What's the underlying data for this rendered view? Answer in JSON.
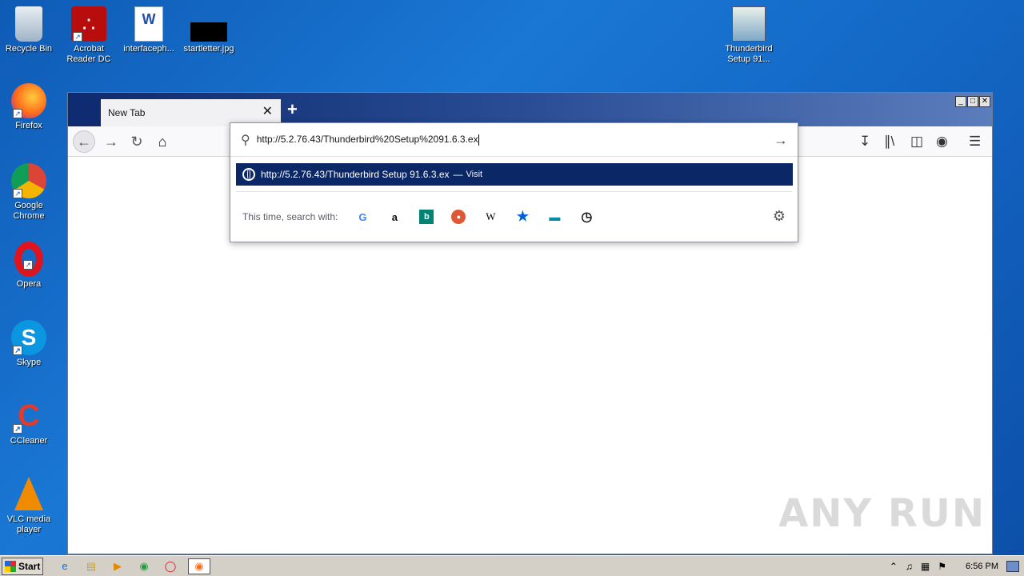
{
  "desktop": {
    "icons": [
      {
        "label": "Recycle Bin",
        "name": "recycle-bin-icon"
      },
      {
        "label": "Acrobat Reader DC",
        "name": "acrobat-icon"
      },
      {
        "label": "interfaceph...",
        "name": "word-document-icon"
      },
      {
        "label": "startletter.jpg",
        "name": "image-file-icon"
      },
      {
        "label": "Thunderbird Setup 91...",
        "name": "installer-icon"
      },
      {
        "label": "Firefox",
        "name": "firefox-icon"
      },
      {
        "label": "Google Chrome",
        "name": "chrome-icon"
      },
      {
        "label": "Opera",
        "name": "opera-icon"
      },
      {
        "label": "Skype",
        "name": "skype-icon"
      },
      {
        "label": "CCleaner",
        "name": "ccleaner-icon"
      },
      {
        "label": "VLC media player",
        "name": "vlc-icon"
      }
    ]
  },
  "browser": {
    "tab_title": "New Tab",
    "new_tab_symbol": "+",
    "url_text": "http://5.2.76.43/Thunderbird%20Setup%2091.6.3.ex",
    "suggestion": {
      "url": "http://5.2.76.43/Thunderbird Setup 91.6.3.ex",
      "separator": "—",
      "action": "Visit"
    },
    "search_with_label": "This time, search with:",
    "engines": [
      "google-icon",
      "amazon-icon",
      "bing-icon",
      "duckduckgo-icon",
      "wikipedia-icon",
      "bookmarks-icon",
      "tabs-icon",
      "history-icon"
    ]
  },
  "watermark": "ANY RUN",
  "taskbar": {
    "start_label": "Start",
    "clock": "6:56 PM"
  },
  "colors": {
    "desktop_blue": "#1468c6",
    "suggestion_highlight": "#0c2766",
    "titlebar_dark": "#0e2a6b"
  }
}
